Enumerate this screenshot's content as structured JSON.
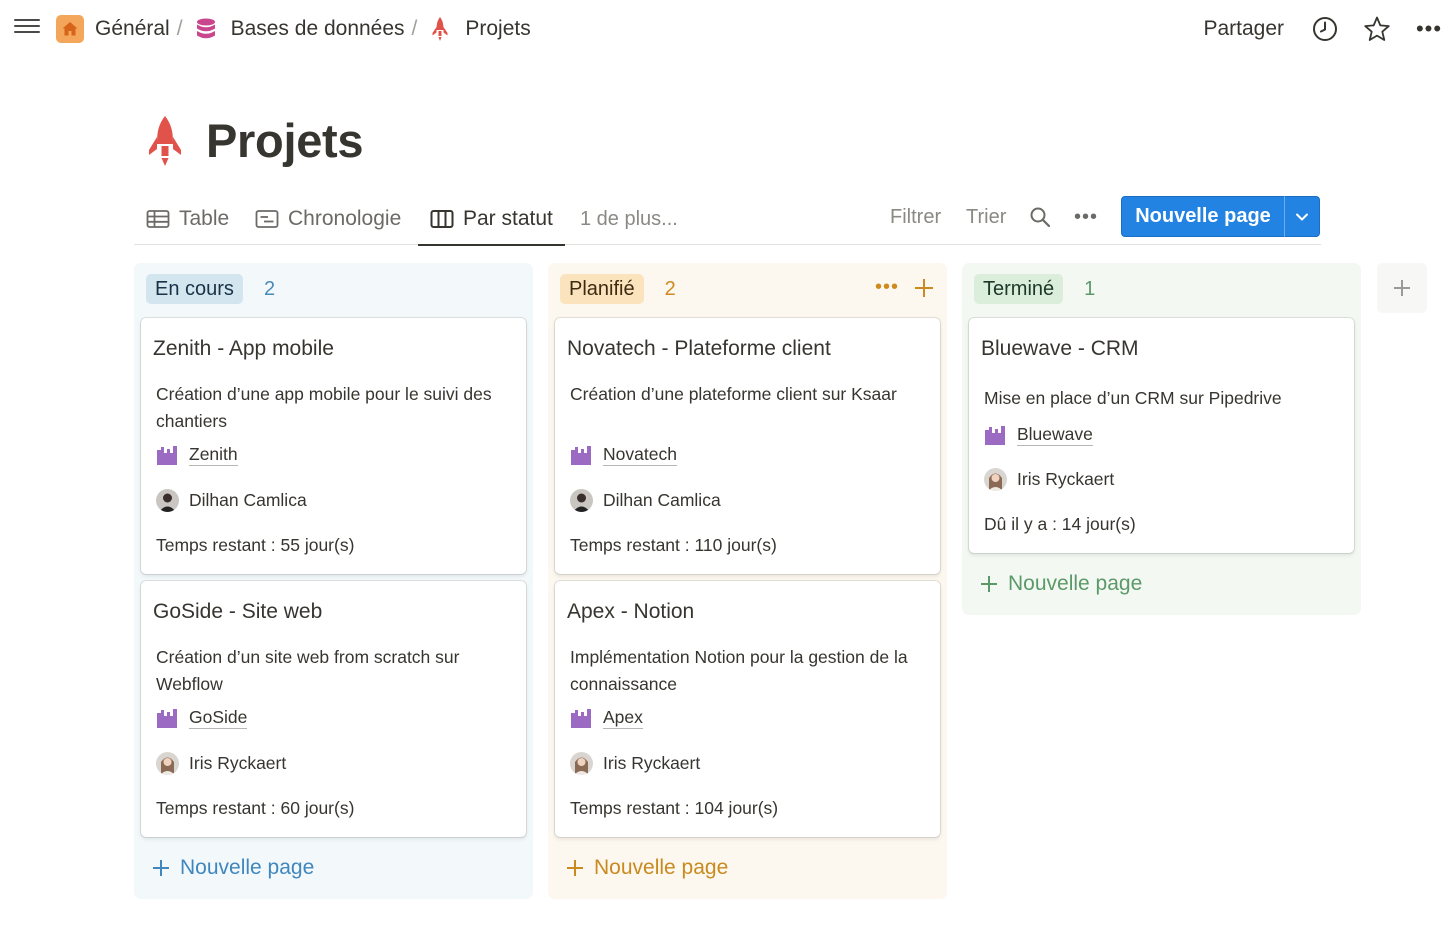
{
  "breadcrumb": [
    {
      "label": "Général",
      "icon": "home-icon"
    },
    {
      "label": "Bases de données",
      "icon": "database-icon"
    },
    {
      "label": "Projets",
      "icon": "rocket-icon"
    }
  ],
  "breadcrumb_separator": "/",
  "topbar": {
    "share_label": "Partager",
    "icons": [
      "clock-icon",
      "star-icon",
      "more-icon"
    ],
    "more_glyph": "•••"
  },
  "page": {
    "title": "Projets",
    "icon": "rocket-icon"
  },
  "views": {
    "tabs": [
      {
        "label": "Table",
        "icon": "table-icon",
        "active": false
      },
      {
        "label": "Chronologie",
        "icon": "timeline-icon",
        "active": false
      },
      {
        "label": "Par statut",
        "icon": "board-icon",
        "active": true
      }
    ],
    "more_label": "1 de plus...",
    "filter_label": "Filtrer",
    "sort_label": "Trier",
    "more_glyph": "•••",
    "new_page_label": "Nouvelle page"
  },
  "columns": [
    {
      "status": "En cours",
      "count": "2",
      "pill_bg": "#d3e5ef",
      "count_color": "#4a8ab8",
      "column_bg": "#f3f8fb",
      "add_color": "#3f87be",
      "add_label": "Nouvelle page",
      "cards": [
        {
          "title": "Zenith - App mobile",
          "description": "Création d’une app mobile pour le suivi des chantiers",
          "company": "Zenith",
          "person": "Dilhan Camlica",
          "info": "Temps restant : 55 jour(s)"
        },
        {
          "title": "GoSide - Site web",
          "description": "Création d’un site web from scratch sur Webflow",
          "company": "GoSide",
          "person": "Iris Ryckaert",
          "info": "Temps restant : 60 jour(s)"
        }
      ]
    },
    {
      "status": "Planifié",
      "count": "2",
      "pill_bg": "#fbe4bd",
      "count_color": "#cf8a1f",
      "column_bg": "#fcf8f0",
      "add_color": "#c98a1f",
      "add_label": "Nouvelle page",
      "tools_glyph": "•••",
      "cards": [
        {
          "title": "Novatech - Plateforme client",
          "description": "Création d’une plateforme client sur Ksaar",
          "company": "Novatech",
          "person": "Dilhan Camlica",
          "info": "Temps restant : 110 jour(s)"
        },
        {
          "title": "Apex - Notion",
          "description": "Implémentation Notion pour la gestion de la connaissance",
          "company": "Apex",
          "person": "Iris Ryckaert",
          "info": "Temps restant : 104 jour(s)"
        }
      ]
    },
    {
      "status": "Terminé",
      "count": "1",
      "pill_bg": "#dbeddb",
      "count_color": "#5b9a68",
      "column_bg": "#f4f8f3",
      "add_color": "#5b9a68",
      "add_label": "Nouvelle page",
      "cards": [
        {
          "title": "Bluewave - CRM",
          "description": "Mise en place d’un CRM sur Pipedrive",
          "company": "Bluewave",
          "person": "Iris Ryckaert",
          "info": "Dû il y a : 14 jour(s)"
        }
      ]
    }
  ],
  "colors": {
    "accent_blue": "#2383e2",
    "rocket_red": "#e0524a",
    "company_purple": "#9b6bc3",
    "text": "#37352f"
  }
}
